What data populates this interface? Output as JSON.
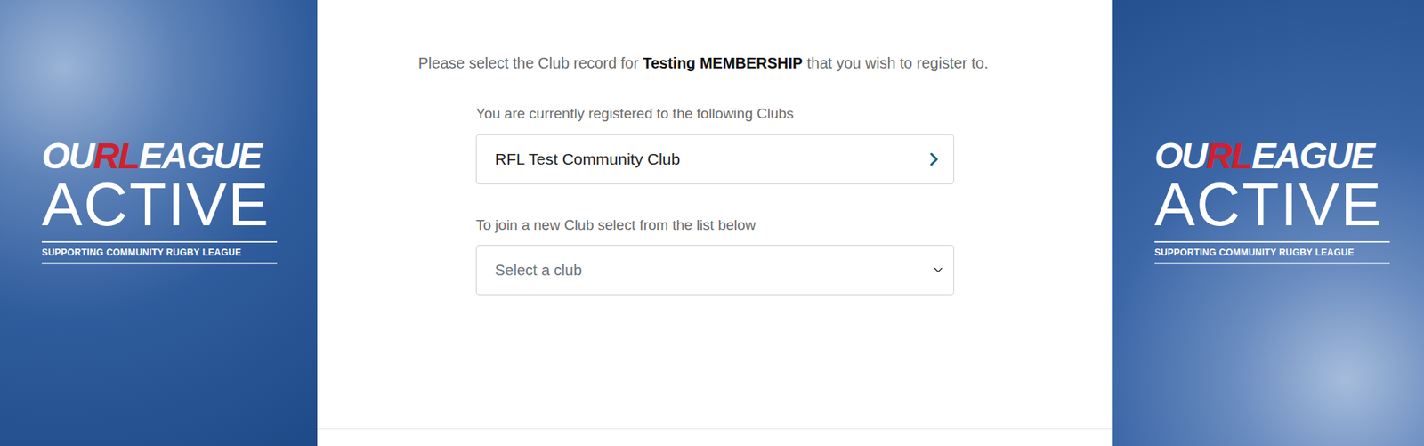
{
  "logo": {
    "prefix": "OU",
    "highlight": "RL",
    "suffix": "EAGUE",
    "title": "ACTIVE",
    "tagline": "SUPPORTING COMMUNITY RUGBY LEAGUE"
  },
  "intro": {
    "before": "Please select the Club record for ",
    "membership": "Testing MEMBERSHIP",
    "after": " that you wish to register to."
  },
  "registered": {
    "label": "You are currently registered to the following Clubs",
    "clubs": [
      {
        "name": "RFL Test Community Club"
      }
    ]
  },
  "join": {
    "label": "To join a new Club select from the list below",
    "placeholder": "Select a club"
  }
}
